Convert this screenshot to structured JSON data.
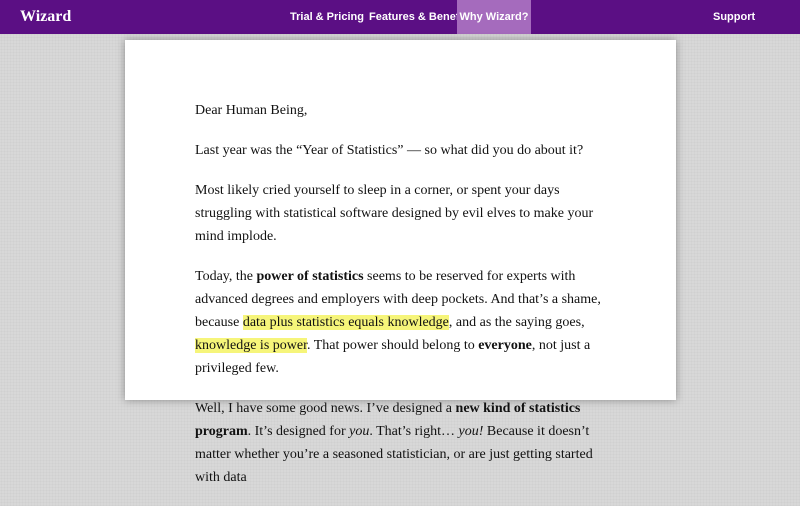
{
  "nav": {
    "brand": "Wizard",
    "items": [
      {
        "label": "Trial & Pricing"
      },
      {
        "label": "Features & Benefits"
      },
      {
        "label": "Why Wizard?"
      },
      {
        "label": "Support"
      }
    ],
    "active_item": "Why Wizard?"
  },
  "letter": {
    "salutation": "Dear Human Being,",
    "p1": "Last year was the “Year of Statistics” — so what did you do about it?",
    "p2": "Most likely cried yourself to sleep in a corner, or spent your days struggling with statistical software designed by evil elves to make your mind implode.",
    "p3": {
      "a": "Today, the ",
      "b": "power of statistics",
      "c": " seems to be reserved for experts with advanced degrees and employers with deep pockets.  And that’s a shame, because ",
      "d": "data plus statistics equals knowledge",
      "e": ", and as the saying goes, ",
      "f": "knowledge is power",
      "g": ".  That power should belong to ",
      "h": "everyone",
      "i": ", not just a privileged few."
    },
    "p4": {
      "a": "Well, I have some good news.  I’ve designed a ",
      "b": "new kind of statistics program",
      "c": ".  It’s designed for ",
      "d": "you",
      "e": ".  That’s right… ",
      "f": "you!",
      "g": "  Because it doesn’t matter whether you’re a seasoned statistician, or are just getting started with data"
    }
  },
  "colors": {
    "nav_bg": "#5b0f84",
    "nav_active_bg": "#a56bbd",
    "highlight": "#f6f57a",
    "page_bg": "#d8d8d8"
  }
}
